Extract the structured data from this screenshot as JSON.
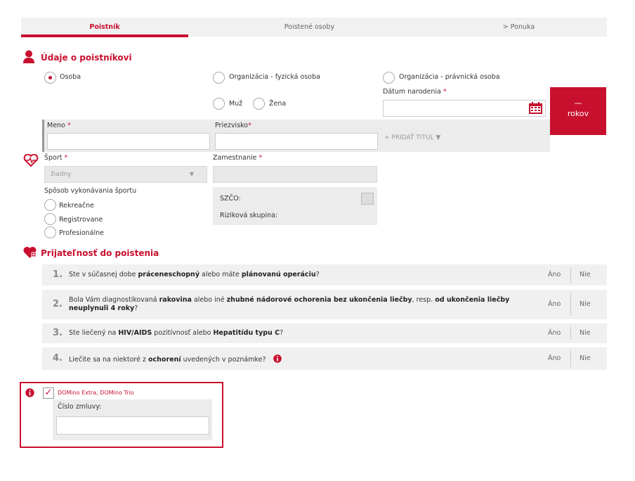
{
  "tabs": [
    {
      "label": "Poistník",
      "active": true
    },
    {
      "label": "Poistené osoby",
      "active": false
    },
    {
      "label": "> Ponuka",
      "active": false
    }
  ],
  "policyholder": {
    "section_title": "Údaje o poistníkovi",
    "type_options": [
      {
        "label": "Osoba",
        "selected": true
      },
      {
        "label": "Organizácia - fyzická osoba",
        "selected": false
      },
      {
        "label": "Organizácia - právnická osoba",
        "selected": false
      }
    ],
    "gender_options": [
      {
        "label": "Muž",
        "selected": false
      },
      {
        "label": "Žena",
        "selected": false
      }
    ],
    "birthdate_label": "Dátum narodenia",
    "required_mark": "*",
    "age": {
      "value": "—",
      "unit": "rokov"
    },
    "first_name_label": "Meno",
    "last_name_label": "Priezvisko",
    "add_title_label": "+ PRIDAŤ TITUL ▼",
    "sport_label": "Šport",
    "sport_value": "žiadny",
    "employment_label": "Zamestnanie",
    "sport_mode_label": "Spôsob vykonávania športu",
    "sport_mode_options": [
      "Rekreačne",
      "Registrovane",
      "Profesionálne"
    ],
    "szco_label": "SZČO:",
    "risk_group_label": "Riziková skupina:"
  },
  "acceptance": {
    "section_title": "Prijateľnosť do poistenia",
    "yes_label": "Áno",
    "no_label": "Nie",
    "questions": [
      {
        "num": "1.",
        "parts": [
          [
            "Ste v súčasnej dobe ",
            false
          ],
          [
            "práceneschopný",
            true
          ],
          [
            " alebo máte ",
            false
          ],
          [
            "plánovanú operáciu",
            true
          ],
          [
            "?",
            false
          ]
        ]
      },
      {
        "num": "2.",
        "parts": [
          [
            "Bola Vám diagnostikovaná ",
            false
          ],
          [
            "rakovina",
            true
          ],
          [
            " alebo iné ",
            false
          ],
          [
            "zhubné nádorové ochorenia bez ukončenia liečby",
            true
          ],
          [
            ", resp. ",
            false
          ],
          [
            "od ukončenia liečby neuplynuli 4 roky",
            true
          ],
          [
            "?",
            false
          ]
        ]
      },
      {
        "num": "3.",
        "parts": [
          [
            "Ste liečený na ",
            false
          ],
          [
            "HIV/AIDS",
            true
          ],
          [
            " pozitívnosť alebo ",
            false
          ],
          [
            "Hepatitídu typu C",
            true
          ],
          [
            "?",
            false
          ]
        ]
      },
      {
        "num": "4.",
        "parts": [
          [
            "Liečite sa na niektoré z ",
            false
          ],
          [
            "ochorení",
            true
          ],
          [
            " uvedených v poznámke?",
            false
          ]
        ]
      }
    ]
  },
  "domino": {
    "checkbox_label": "DOMino Extra, DOMino Trio",
    "checked": true,
    "contract_label": "Číslo zmluvy:",
    "contract_value": ""
  },
  "colors": {
    "accent": "#c8102e",
    "panel": "#ececec",
    "row": "#f0f0f0"
  }
}
